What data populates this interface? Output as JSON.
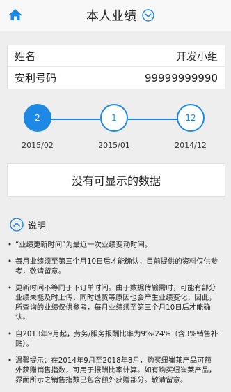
{
  "header": {
    "title": "本人业绩"
  },
  "info": {
    "name_label": "姓名",
    "name_value": "开发小组",
    "id_label": "安利号码",
    "id_value": "99999999990"
  },
  "timeline": [
    {
      "number": "2",
      "date": "2015/02",
      "active": true
    },
    {
      "number": "1",
      "date": "2015/01",
      "active": false
    },
    {
      "number": "12",
      "date": "2014/12",
      "active": false
    }
  ],
  "no_data": "没有可显示的数据",
  "notes": {
    "title": "说明",
    "items": [
      "“业绩更新时间”为最近一次业绩变动时间。",
      "每月业绩须至第三个月10日后才能确认，目前提供的资料仅供参考，敬请留意。",
      "更新时间不等同于下订单时间。由于数据传输需时，可能有部分业绩未能及时上传，同时退货等原因也会产生业绩变化，因此，所查询的业绩仅供参考，每月业绩须至第三个月10日后才能确认。",
      "自2013年9月起，劳务/服务报酬比率为9%-24%（含3%销售补贴）。",
      "温馨提示：在2014年9月至2018年8月，购买纽崔莱产品可额外获赠销售指数，可用于报酬比率计算。如有购买纽崔莱产品，界面所示之销售指数已包含额外获赠部分。敬请留意。"
    ]
  },
  "colors": {
    "accent": "#1e88e5",
    "background": "#eeeeee"
  },
  "icons": {
    "home": "home-icon",
    "chevron": "chevron-down-circle-icon",
    "collapse": "chevron-up-circle-icon"
  }
}
